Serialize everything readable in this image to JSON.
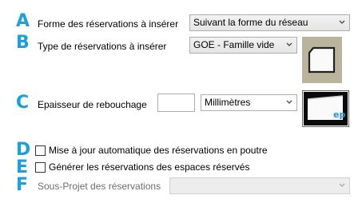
{
  "rows": {
    "a": {
      "letter": "A",
      "label": "Forme des réservations à insérer",
      "select_value": "Suivant la forme du réseau"
    },
    "b": {
      "letter": "B",
      "label": "Type de réservations à insérer",
      "select_value": "GOE - Famille vide"
    },
    "c": {
      "letter": "C",
      "label": "Epaisseur de rebouchage",
      "input_value": "",
      "unit_value": "Millimètres",
      "preview_text": "ep"
    },
    "d": {
      "letter": "D",
      "label": "Mise à jour automatique des réservations en poutre",
      "checked": false
    },
    "e": {
      "letter": "E",
      "label": "Générer les réservations des espaces réservés",
      "checked": false
    },
    "f": {
      "letter": "F",
      "label": "Sous-Projet des réservations",
      "select_value": ""
    }
  },
  "colors": {
    "letter": "#1aa0dc",
    "preview_bg": "#bab49c"
  }
}
